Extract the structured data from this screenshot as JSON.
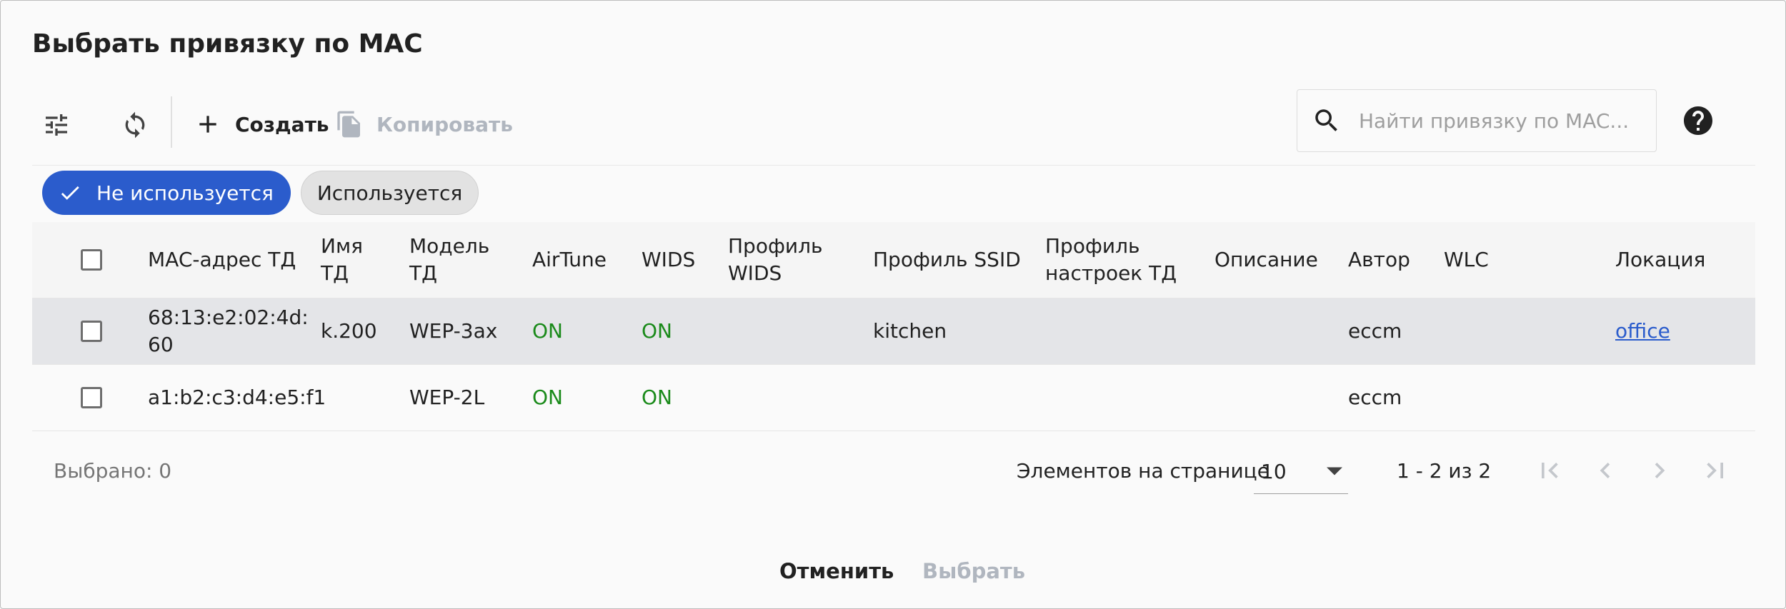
{
  "dialog": {
    "title": "Выбрать привязку по MAC"
  },
  "toolbar": {
    "filter_icon": "tune-icon",
    "refresh_icon": "sync-icon",
    "create_label": "Создать",
    "copy_label": "Копировать",
    "search_placeholder": "Найти привязку по MAC...",
    "search_value": "",
    "help_icon": "help-circle-icon"
  },
  "filters": {
    "not_used": "Не используется",
    "used": "Используется"
  },
  "table": {
    "headers": {
      "mac": "MAC-адрес ТД",
      "name": "Имя ТД",
      "model": "Модель ТД",
      "airtune": "AirTune",
      "wids": "WIDS",
      "wids_profile": "Профиль WIDS",
      "ssid_profile": "Профиль SSID",
      "settings_profile": "Профиль настроек ТД",
      "description": "Описание",
      "author": "Автор",
      "wlc": "WLC",
      "location": "Локация"
    },
    "rows": [
      {
        "mac": "68:13:e2:02:4d:60",
        "name": "k.200",
        "model": "WEP-3ax",
        "airtune": "ON",
        "wids": "ON",
        "wids_profile": "",
        "ssid_profile": "kitchen",
        "settings_profile": "",
        "description": "",
        "author": "eccm",
        "wlc": "",
        "location": "office"
      },
      {
        "mac": "a1:b2:c3:d4:e5:f1",
        "name": "",
        "model": "WEP-2L",
        "airtune": "ON",
        "wids": "ON",
        "wids_profile": "",
        "ssid_profile": "",
        "settings_profile": "",
        "description": "",
        "author": "eccm",
        "wlc": "",
        "location": ""
      }
    ]
  },
  "footer": {
    "selected": "Выбрано: 0",
    "per_page_label": "Элементов на странице",
    "per_page_value": "10",
    "range": "1 - 2 из 2"
  },
  "actions": {
    "cancel": "Отменить",
    "select": "Выбрать"
  },
  "colors": {
    "primary": "#2b5ccc",
    "on_status": "#1a8a1a",
    "disabled": "#b0b6bf"
  }
}
